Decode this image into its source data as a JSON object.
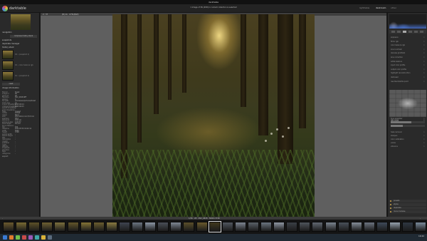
{
  "window": {
    "title": "darktable"
  },
  "header": {
    "app_name": "darktable",
    "status": "1 image of 36 (#28) in current collection is selected",
    "views": [
      "lighttable",
      "darkroom",
      "other"
    ]
  },
  "left_panel": {
    "sections": [
      "navigation",
      "snapshots",
      "duplicate manager",
      "history stack",
      "image information"
    ],
    "history_buttons": [
      "compress history stack",
      "reset"
    ],
    "snapshot_labels": [
      "04 • (snapshot 1)",
      "02 • color balance rgb",
      "01 • (snapshot 2)"
    ],
    "image_info": [
      [
        "filmroll",
        "forest"
      ],
      [
        "image id",
        "28"
      ],
      [
        "group id",
        "28"
      ],
      [
        "filename",
        "DSC_0828.NEF"
      ],
      [
        "version",
        "0"
      ],
      [
        "full path",
        "/home/user/pictures/forest"
      ],
      [
        "local copy",
        "no"
      ],
      [
        "import timestamp",
        "2023:06:14"
      ],
      [
        "change timestamp",
        "2023:06:15"
      ],
      [
        "export timestamp",
        "-"
      ],
      [
        "print timestamp",
        "-"
      ],
      [
        "flags",
        "unused"
      ],
      [
        "model",
        "D7500"
      ],
      [
        "maker",
        "Nikon"
      ],
      [
        "lens",
        "18.0-140.0 mm f/3.5-5.6"
      ],
      [
        "aperture",
        "f/8.0"
      ],
      [
        "exposure",
        "1/60 sec"
      ],
      [
        "exposure bias",
        "0.00 EV"
      ],
      [
        "focal length",
        "18 mm"
      ],
      [
        "focus distance",
        "-"
      ],
      [
        "ISO",
        "200"
      ],
      [
        "datetime",
        "2023:05:30 19:42:11"
      ],
      [
        "width",
        "5600"
      ],
      [
        "height",
        "3728"
      ],
      [
        "export width",
        "-"
      ],
      [
        "export height",
        "-"
      ],
      [
        "title",
        "-"
      ],
      [
        "description",
        "-"
      ],
      [
        "creator",
        "-"
      ],
      [
        "publisher",
        "-"
      ],
      [
        "rights",
        "-"
      ],
      [
        "latitude",
        "-"
      ],
      [
        "longitude",
        "-"
      ],
      [
        "elevation",
        "-"
      ],
      [
        "tags",
        "-"
      ],
      [
        "categories",
        "-"
      ]
    ],
    "footer": "export"
  },
  "center_top": {
    "left": "2 : 37",
    "right": "(B) 14 · 4 FN (B/W)"
  },
  "right_panel": {
    "modules": [
      "exposure",
      "filmic rgb",
      "color balance rgb",
      "local contrast",
      "denoise (profiled)",
      "lens correction",
      "white balance",
      "input color profile",
      "output color profile",
      "highlight reconstruction",
      "demosaic",
      "raw black/white point"
    ],
    "tone_modules": [
      "tone equalizer",
      "rgb curve",
      "rgb levels"
    ],
    "lower_modules": [
      "haze removal",
      "sharpen",
      "color calibration",
      "velvia",
      "vibrance"
    ],
    "bottom_items": [
      "presets",
      "styles",
      "duplicate",
      "more modules"
    ]
  },
  "film_bar": {
    "left": "-",
    "center": "1/36 · 28 · DSC_0828 · 5600×3728",
    "right": "-"
  },
  "filmstrip": {
    "thumbs": [
      "#6b5a2e",
      "#7a6a33",
      "#5d5128",
      "#6e6032",
      "#7c6f3d",
      "#63562a",
      "#857436",
      "#6a5d2f",
      "#8a7b40",
      "#3e4450",
      "#6a7480",
      "#8c96a4",
      "#4a4f58",
      "#7e8894",
      "#5b4f2a",
      "#6a5a2c",
      "#40381c",
      "#50565e",
      "#7d8591",
      "#5a6068",
      "#6b7580",
      "#8e96a2",
      "#3a3f46",
      "#4f555c",
      "#606770",
      "#7b848f",
      "#49505a",
      "#858e99",
      "#6c7480",
      "#3e4a5a",
      "#95a0ad",
      "#2f3742",
      "#7a8a9a"
    ],
    "selected_index": 16
  },
  "taskbar": {
    "time": "19:42",
    "date": "2023-06-15",
    "icons": [
      "#3a7bd5",
      "#e07b2e",
      "#6fbf4a",
      "#c84b4b",
      "#9b59b6",
      "#3fa7a7",
      "#d9b23a",
      "#5a6b7d"
    ]
  }
}
